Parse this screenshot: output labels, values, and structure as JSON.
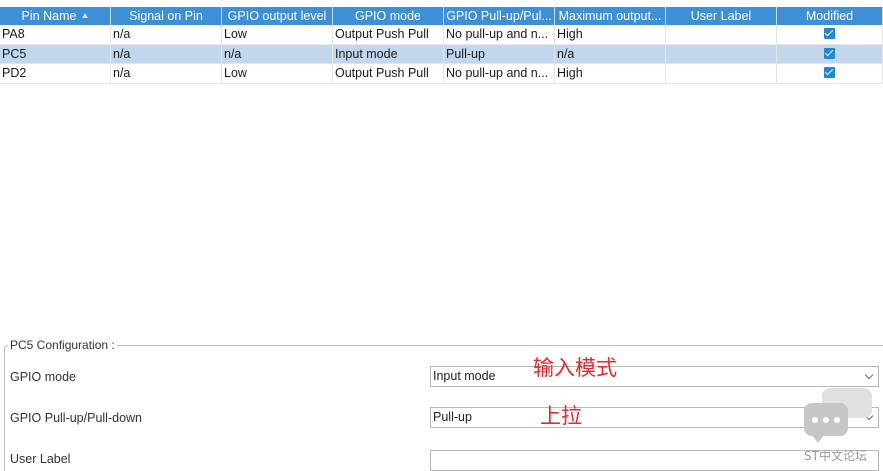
{
  "table": {
    "columns": [
      "Pin Name",
      "Signal on Pin",
      "GPIO output level",
      "GPIO mode",
      "GPIO Pull-up/Pul...",
      "Maximum output...",
      "User Label",
      "Modified"
    ],
    "sort_icon": "sort-ascending-icon",
    "selected_row_index": 1,
    "rows": [
      [
        "PA8",
        "n/a",
        "Low",
        "Output Push Pull",
        "No pull-up and n...",
        "High",
        ""
      ],
      [
        "PC5",
        "n/a",
        "n/a",
        "Input mode",
        "Pull-up",
        "n/a",
        ""
      ],
      [
        "PD2",
        "n/a",
        "Low",
        "Output Push Pull",
        "No pull-up and n...",
        "High",
        ""
      ]
    ],
    "modified": [
      true,
      true,
      true
    ],
    "colors": {
      "header_bg": "#3d8fd6",
      "selected_row_bg": "#c3d7ec",
      "check_bg": "#1f86d9"
    }
  },
  "config": {
    "title": "PC5 Configuration :",
    "fields": [
      {
        "label": "GPIO mode",
        "value": "Input mode",
        "annotation": "输入模式"
      },
      {
        "label": "GPIO Pull-up/Pull-down",
        "value": "Pull-up",
        "annotation": "上拉"
      },
      {
        "label": "User Label",
        "value": ""
      }
    ],
    "annotation_color": "#e8282a"
  },
  "watermark": {
    "text": "ST中文论坛",
    "icon": "chat-bubble-icon"
  }
}
